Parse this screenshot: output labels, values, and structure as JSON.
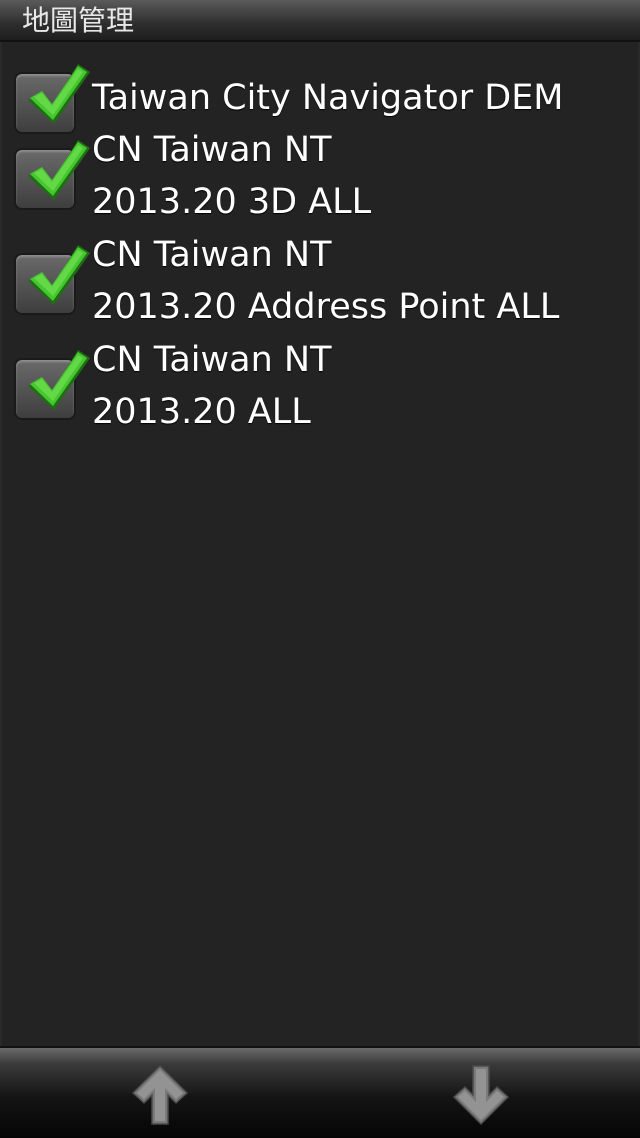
{
  "header": {
    "title": "地圖管理"
  },
  "maps": [
    {
      "checked": true,
      "line1": "Taiwan City Navigator DEM",
      "line2": ""
    },
    {
      "checked": true,
      "line1": "CN Taiwan NT",
      "line2": "2013.20 3D ALL"
    },
    {
      "checked": true,
      "line1": "CN Taiwan NT",
      "line2": "2013.20 Address Point ALL"
    },
    {
      "checked": true,
      "line1": "CN Taiwan NT",
      "line2": "2013.20 ALL"
    }
  ],
  "footer": {
    "up_icon": "arrow-up-icon",
    "down_icon": "arrow-down-icon"
  },
  "colors": {
    "check": "#3fbf2a",
    "background": "#232323",
    "text": "#ffffff"
  }
}
